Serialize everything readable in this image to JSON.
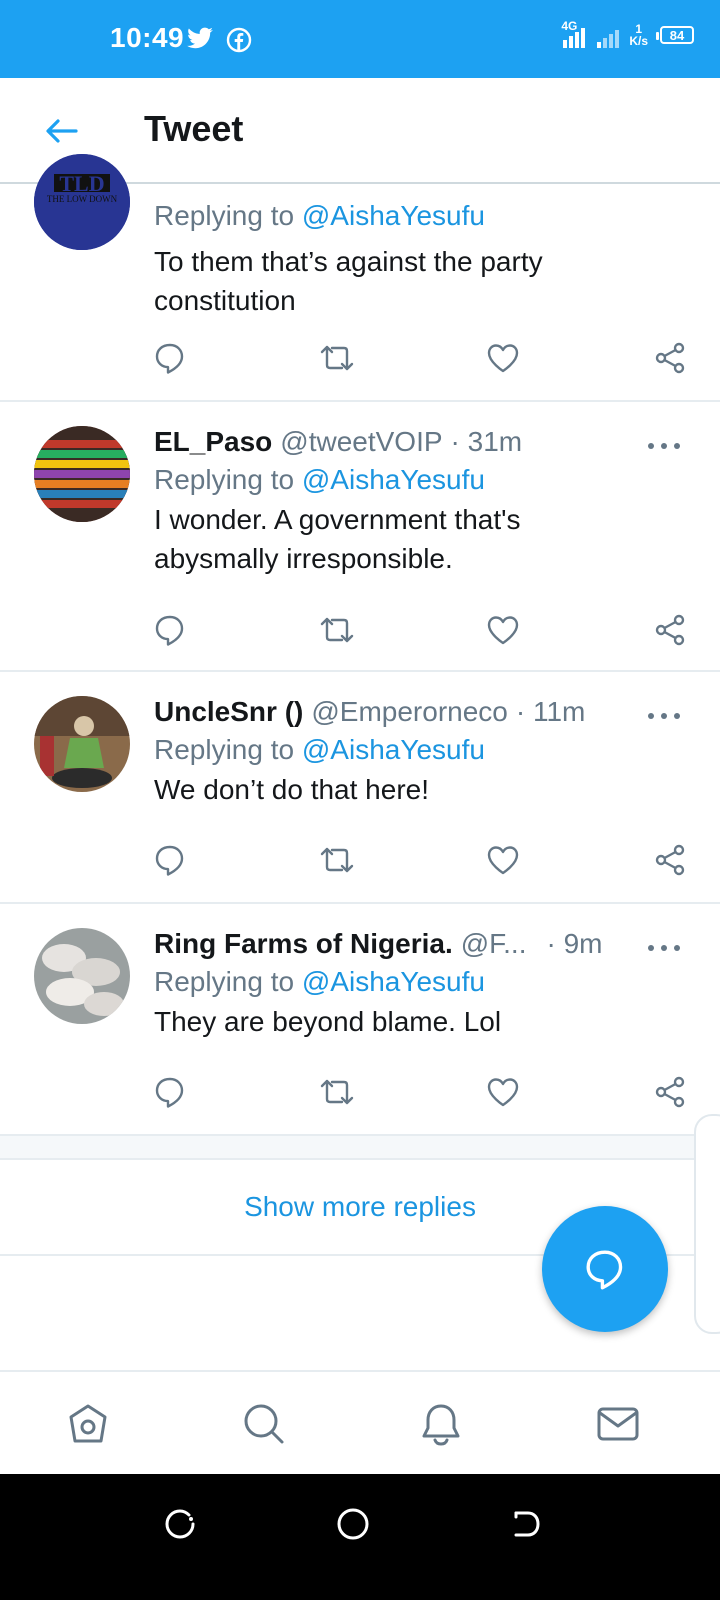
{
  "status_bar": {
    "time": "10:49",
    "network": "4G",
    "speed_value": "1",
    "speed_unit": "K/s",
    "battery": "84",
    "icons": [
      "twitter-icon",
      "facebook-icon",
      "signal-icon",
      "battery-icon"
    ]
  },
  "header": {
    "title": "Tweet",
    "back_icon": "arrow-left-icon"
  },
  "colors": {
    "brand": "#1da1f2",
    "link": "#1b95e0",
    "muted": "#657786",
    "text": "#14171a"
  },
  "tweets": [
    {
      "name": "",
      "handle": "",
      "time": "",
      "replying_prefix": "Replying to",
      "replying_to": "@AishaYesufu",
      "text": "To them that’s against the party constitution",
      "avatar_text": "TLD",
      "avatar_subtext": "THE LOW DOWN"
    },
    {
      "name": "EL_Paso",
      "handle": "@tweetVOIP",
      "time": "· 31m",
      "replying_prefix": "Replying to",
      "replying_to": "@AishaYesufu",
      "text": "I wonder. A government that's abysmally irresponsible."
    },
    {
      "name": "UncleSnr ()",
      "handle": "@Emperorneco",
      "time": "· 11m",
      "replying_prefix": "Replying to",
      "replying_to": "@AishaYesufu",
      "text": "We don’t do that here!"
    },
    {
      "name": "Ring Farms of Nigeria.",
      "handle": "@F...",
      "time": "· 9m",
      "replying_prefix": "Replying to",
      "replying_to": "@AishaYesufu",
      "text": "They are beyond blame. Lol"
    }
  ],
  "actions": [
    "reply-icon",
    "retweet-icon",
    "like-icon",
    "share-icon"
  ],
  "show_more": "Show more replies",
  "fab_icon": "compose-reply-icon",
  "bottom_nav": [
    "home-icon",
    "search-icon",
    "notifications-icon",
    "messages-icon"
  ],
  "system_nav": [
    "recents-icon",
    "home-circle-icon",
    "back-icon"
  ]
}
